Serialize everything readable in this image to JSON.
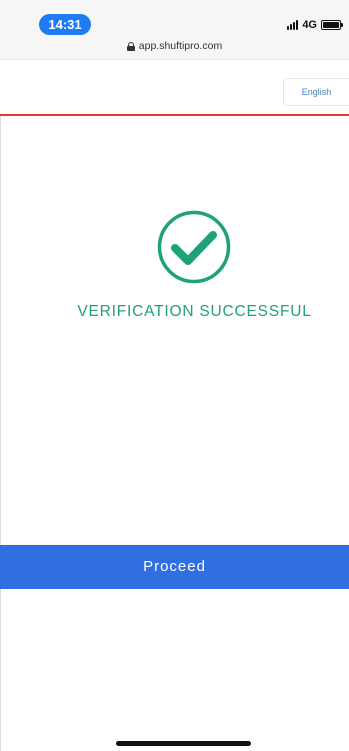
{
  "status_bar": {
    "time": "14:31",
    "network": "4G"
  },
  "browser": {
    "url": "app.shuftipro.com"
  },
  "header": {
    "language": "English"
  },
  "main": {
    "status_icon": "check-circle-icon",
    "status_text": "VERIFICATION SUCCESSFUL",
    "proceed_label": "Proceed"
  },
  "colors": {
    "success": "#1fa17a",
    "primary_button": "#2f6fe0",
    "header_rule": "#e53935",
    "time_pill": "#1f7cf2"
  }
}
